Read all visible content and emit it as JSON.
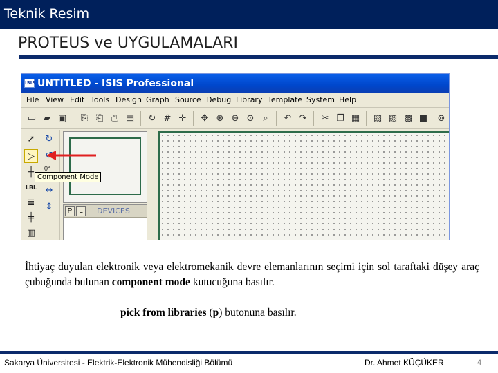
{
  "slide": {
    "header": "Teknik Resim",
    "title": "PROTEUS ve UYGULAMALARI"
  },
  "screenshot": {
    "app_icon_text": "ISIS",
    "window_title": "UNTITLED - ISIS Professional",
    "menu": [
      "File",
      "View",
      "Edit",
      "Tools",
      "Design",
      "Graph",
      "Source",
      "Debug",
      "Library",
      "Template",
      "System",
      "Help"
    ],
    "toolbar_icons": [
      "new-file-icon",
      "open-file-icon",
      "save-icon",
      "import-icon",
      "export-icon",
      "print-icon",
      "area-icon",
      "refresh-icon",
      "grid-icon",
      "origin-icon",
      "pan-icon",
      "zoom-in-icon",
      "zoom-out-icon",
      "zoom-all-icon",
      "zoom-area-icon",
      "undo-icon",
      "redo-icon",
      "cut-icon",
      "copy-icon",
      "paste-icon",
      "block-copy-icon",
      "block-move-icon",
      "block-rotate-icon",
      "block-delete-icon",
      "search-icon"
    ],
    "left_tools": [
      "selection-mode-icon",
      "component-mode-icon",
      "junction-dot-icon",
      "wire-label-icon",
      "text-script-icon",
      "bus-icon",
      "subcircuit-icon",
      "terminal-icon"
    ],
    "rotation_tools": [
      "rotate-clockwise-icon",
      "rotate-anticlockwise-icon",
      "mirror-horizontal-icon",
      "mirror-vertical-icon"
    ],
    "orientation": "0°",
    "tooltip": "Component Mode",
    "devices": {
      "pick_button": "P",
      "library_button": "L",
      "label": "DEVICES"
    }
  },
  "body": {
    "line1_a": "İhtiyaç duyulan elektronik veya elektromekanik devre elemanlarının seçimi için sol taraftaki düşey araç çubuğunda bulunan ",
    "line1_bold": "component mode",
    "line1_b": " kutucuğuna basılır.",
    "line2_bold1": "pick from libraries",
    "line2_mid": " (",
    "line2_bold2": "p",
    "line2_end": ") butonuna basılır."
  },
  "footer": {
    "left": "Sakarya Üniversitesi - Elektrik-Elektronik Mühendisliği Bölümü",
    "author": "Dr. Ahmet KÜÇÜKER",
    "page": "4"
  },
  "colors": {
    "header_bar": "#00205b",
    "rule": "#0b2a6b",
    "xp_title": "#0047cc",
    "arrow": "#e02020",
    "tooltip_bg": "#ffffe1"
  }
}
